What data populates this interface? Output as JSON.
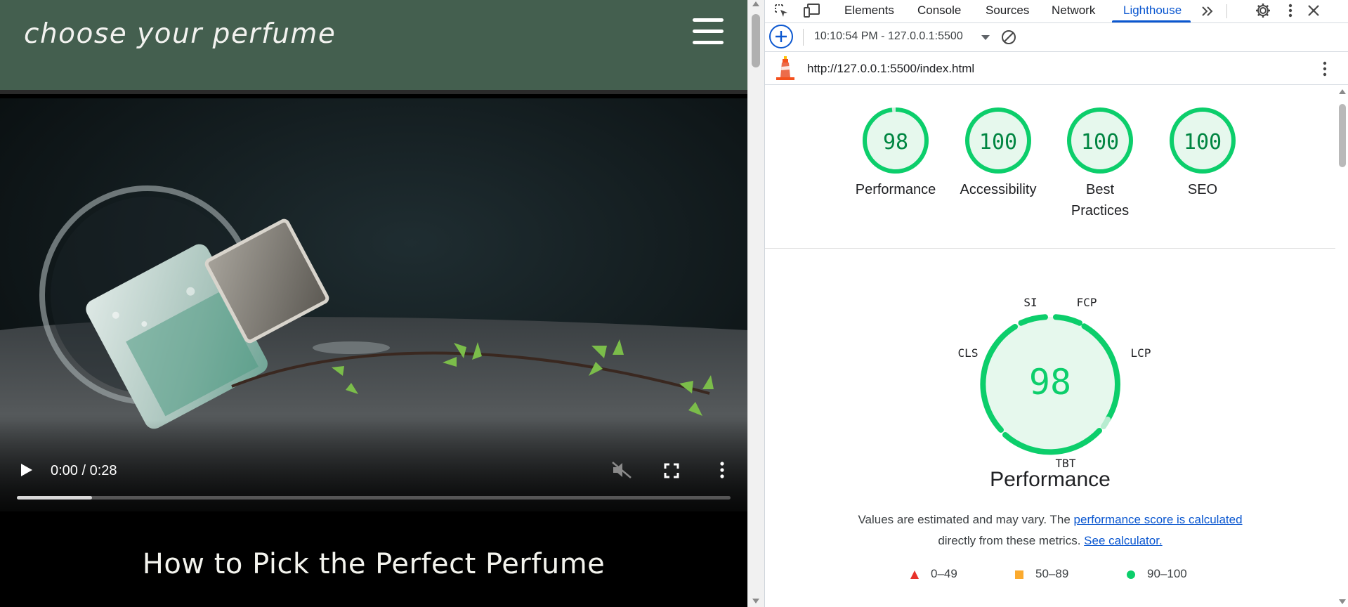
{
  "site": {
    "title": "choose your perfume",
    "headline": "How to Pick the Perfect Perfume",
    "header_color": "#445f4f"
  },
  "video": {
    "time": "0:00 / 0:28",
    "progress_buffered": 0.105,
    "muted": true
  },
  "devtools": {
    "tabs": [
      "Elements",
      "Console",
      "Sources",
      "Network",
      "Lighthouse"
    ],
    "active_tab": "Lighthouse",
    "report_select": "10:10:54 PM - 127.0.0.1:5500",
    "report_url": "http://127.0.0.1:5500/index.html",
    "accent": "#0b57d0"
  },
  "scores": [
    {
      "label": "Performance",
      "value": "98"
    },
    {
      "label": "Accessibility",
      "value": "100"
    },
    {
      "label": "Best Practices",
      "value": "100"
    },
    {
      "label": "SEO",
      "value": "100"
    }
  ],
  "performance": {
    "score": "98",
    "title": "Performance",
    "metrics": [
      "SI",
      "FCP",
      "LCP",
      "TBT",
      "CLS"
    ],
    "desc_text": "Values are estimated and may vary. The ",
    "desc_link": "performance score is calculated",
    "desc_text2": "directly from these metrics.",
    "desc_link2": "See calculator."
  },
  "legend": [
    {
      "range": "0–49",
      "shape": "triangle",
      "color": "#e8322b"
    },
    {
      "range": "50–89",
      "shape": "square",
      "color": "#fbaa2e"
    },
    {
      "range": "90–100",
      "shape": "circle",
      "color": "#0cce6b"
    }
  ],
  "colors": {
    "pass": "#0cce6b",
    "pass_text": "#018642",
    "pass_fill": "#e6f8ed"
  }
}
